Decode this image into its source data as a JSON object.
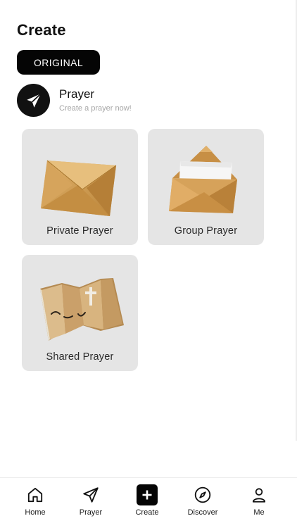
{
  "header": {
    "title": "Create"
  },
  "tabs": {
    "original_label": "ORIGINAL"
  },
  "section": {
    "icon": "paper-plane-icon",
    "title": "Prayer",
    "subtitle": "Create a prayer now!"
  },
  "cards": [
    {
      "label": "Private Prayer",
      "icon": "closed-envelope-icon"
    },
    {
      "label": "Group Prayer",
      "icon": "open-envelope-icon"
    },
    {
      "label": "Shared Prayer",
      "icon": "folded-map-icon"
    }
  ],
  "bottom_nav": [
    {
      "label": "Home",
      "icon": "home-icon"
    },
    {
      "label": "Prayer",
      "icon": "paper-plane-icon"
    },
    {
      "label": "Create",
      "icon": "plus-icon"
    },
    {
      "label": "Discover",
      "icon": "compass-icon"
    },
    {
      "label": "Me",
      "icon": "person-icon"
    }
  ],
  "colors": {
    "accent": "#050505",
    "card_background": "#e5e5e5",
    "subtitle_gray": "#a6a6a6",
    "envelope_gold": "#d9a85f"
  }
}
